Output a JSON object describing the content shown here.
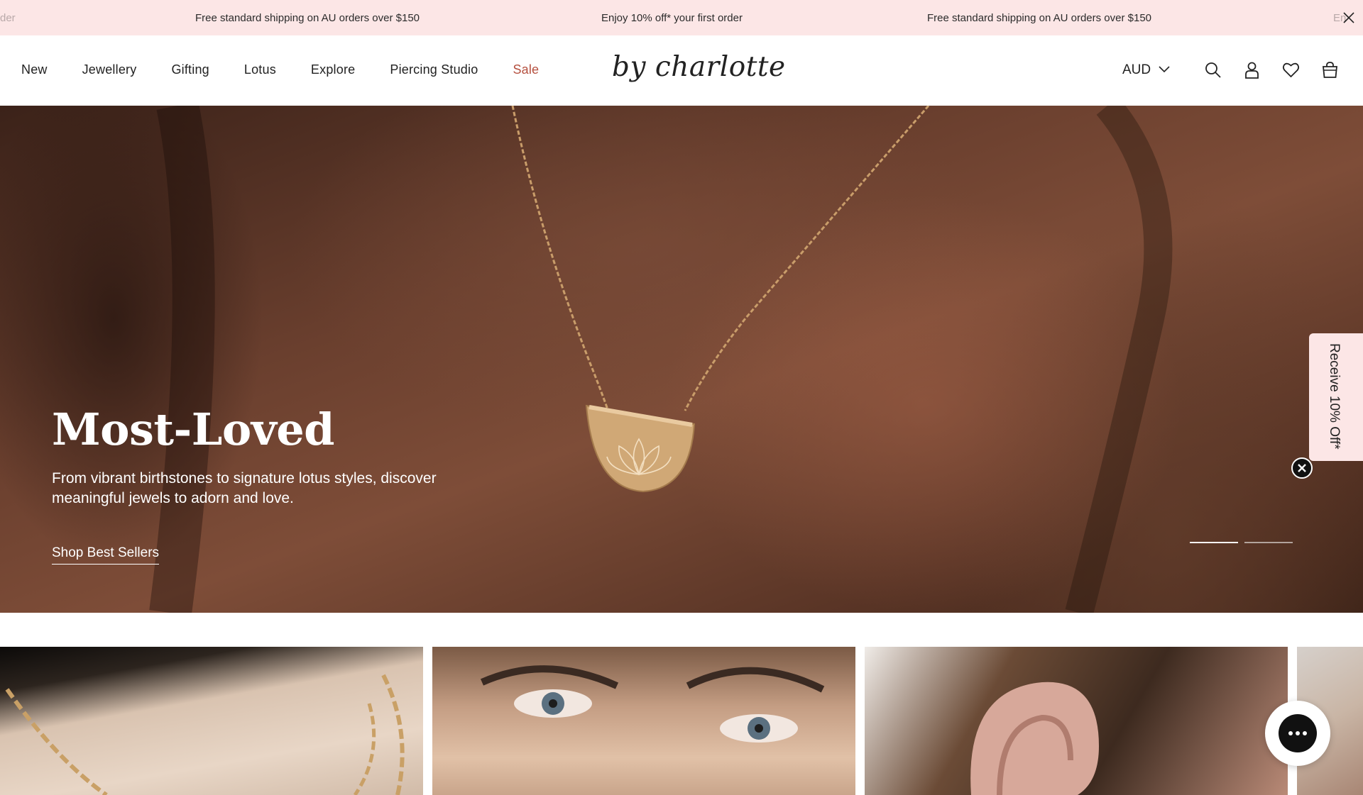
{
  "announcement": {
    "messages": [
      "der",
      "Free standard shipping on AU orders over $150",
      "Enjoy 10% off* your first order",
      "Free standard shipping on AU orders over $150",
      "En"
    ]
  },
  "nav": {
    "items": [
      "New",
      "Jewellery",
      "Gifting",
      "Lotus",
      "Explore",
      "Piercing Studio",
      "Sale"
    ]
  },
  "logo": "by charlotte",
  "currency": "AUD",
  "hero": {
    "title": "Most-Loved",
    "subtitle": "From vibrant birthstones to signature lotus styles, discover meaningful jewels to adorn and love.",
    "cta": "Shop Best Sellers",
    "slide_count": 2,
    "active_slide": 1
  },
  "promo_tab": "Receive 10% Off*",
  "colors": {
    "announce_bg": "#fce6e6",
    "sale": "#b5503f"
  }
}
